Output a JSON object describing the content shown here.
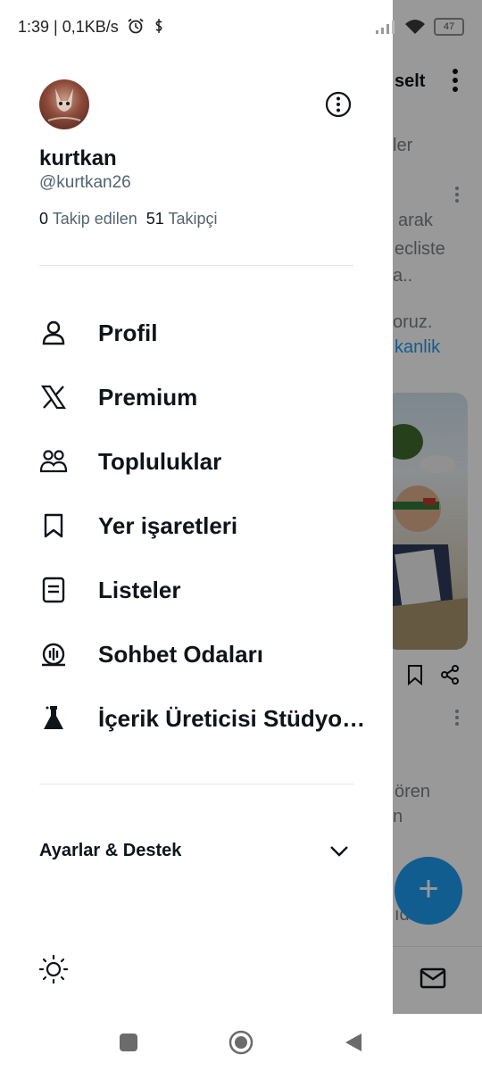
{
  "status_bar": {
    "left_text": "1:39 | 0,1KB/s",
    "battery": "47"
  },
  "background_feed": {
    "title_fragment": "selt",
    "tab_fragment": "ler",
    "text_fragments": [
      "arak",
      "ecliste",
      "a..",
      "oruz."
    ],
    "link_fragment": "kanlik",
    "text_fragments_2": [
      "ören",
      "n",
      "ıdı"
    ]
  },
  "profile": {
    "display_name": "kurtkan",
    "handle": "@kurtkan26",
    "following_count": "0",
    "following_label": "Takip edilen",
    "followers_count": "51",
    "followers_label": "Takipçi"
  },
  "menu": [
    {
      "label": "Profil",
      "icon": "person-icon"
    },
    {
      "label": "Premium",
      "icon": "x-logo-icon"
    },
    {
      "label": "Topluluklar",
      "icon": "communities-icon"
    },
    {
      "label": "Yer işaretleri",
      "icon": "bookmark-icon"
    },
    {
      "label": "Listeler",
      "icon": "list-icon"
    },
    {
      "label": "Sohbet Odaları",
      "icon": "spaces-icon"
    },
    {
      "label": "İçerik Üreticisi Stüdyosu",
      "icon": "flask-icon"
    }
  ],
  "settings": {
    "label": "Ayarlar & Destek"
  },
  "colors": {
    "accent": "#1d9bf0",
    "text": "#0f1419",
    "muted": "#536471"
  }
}
